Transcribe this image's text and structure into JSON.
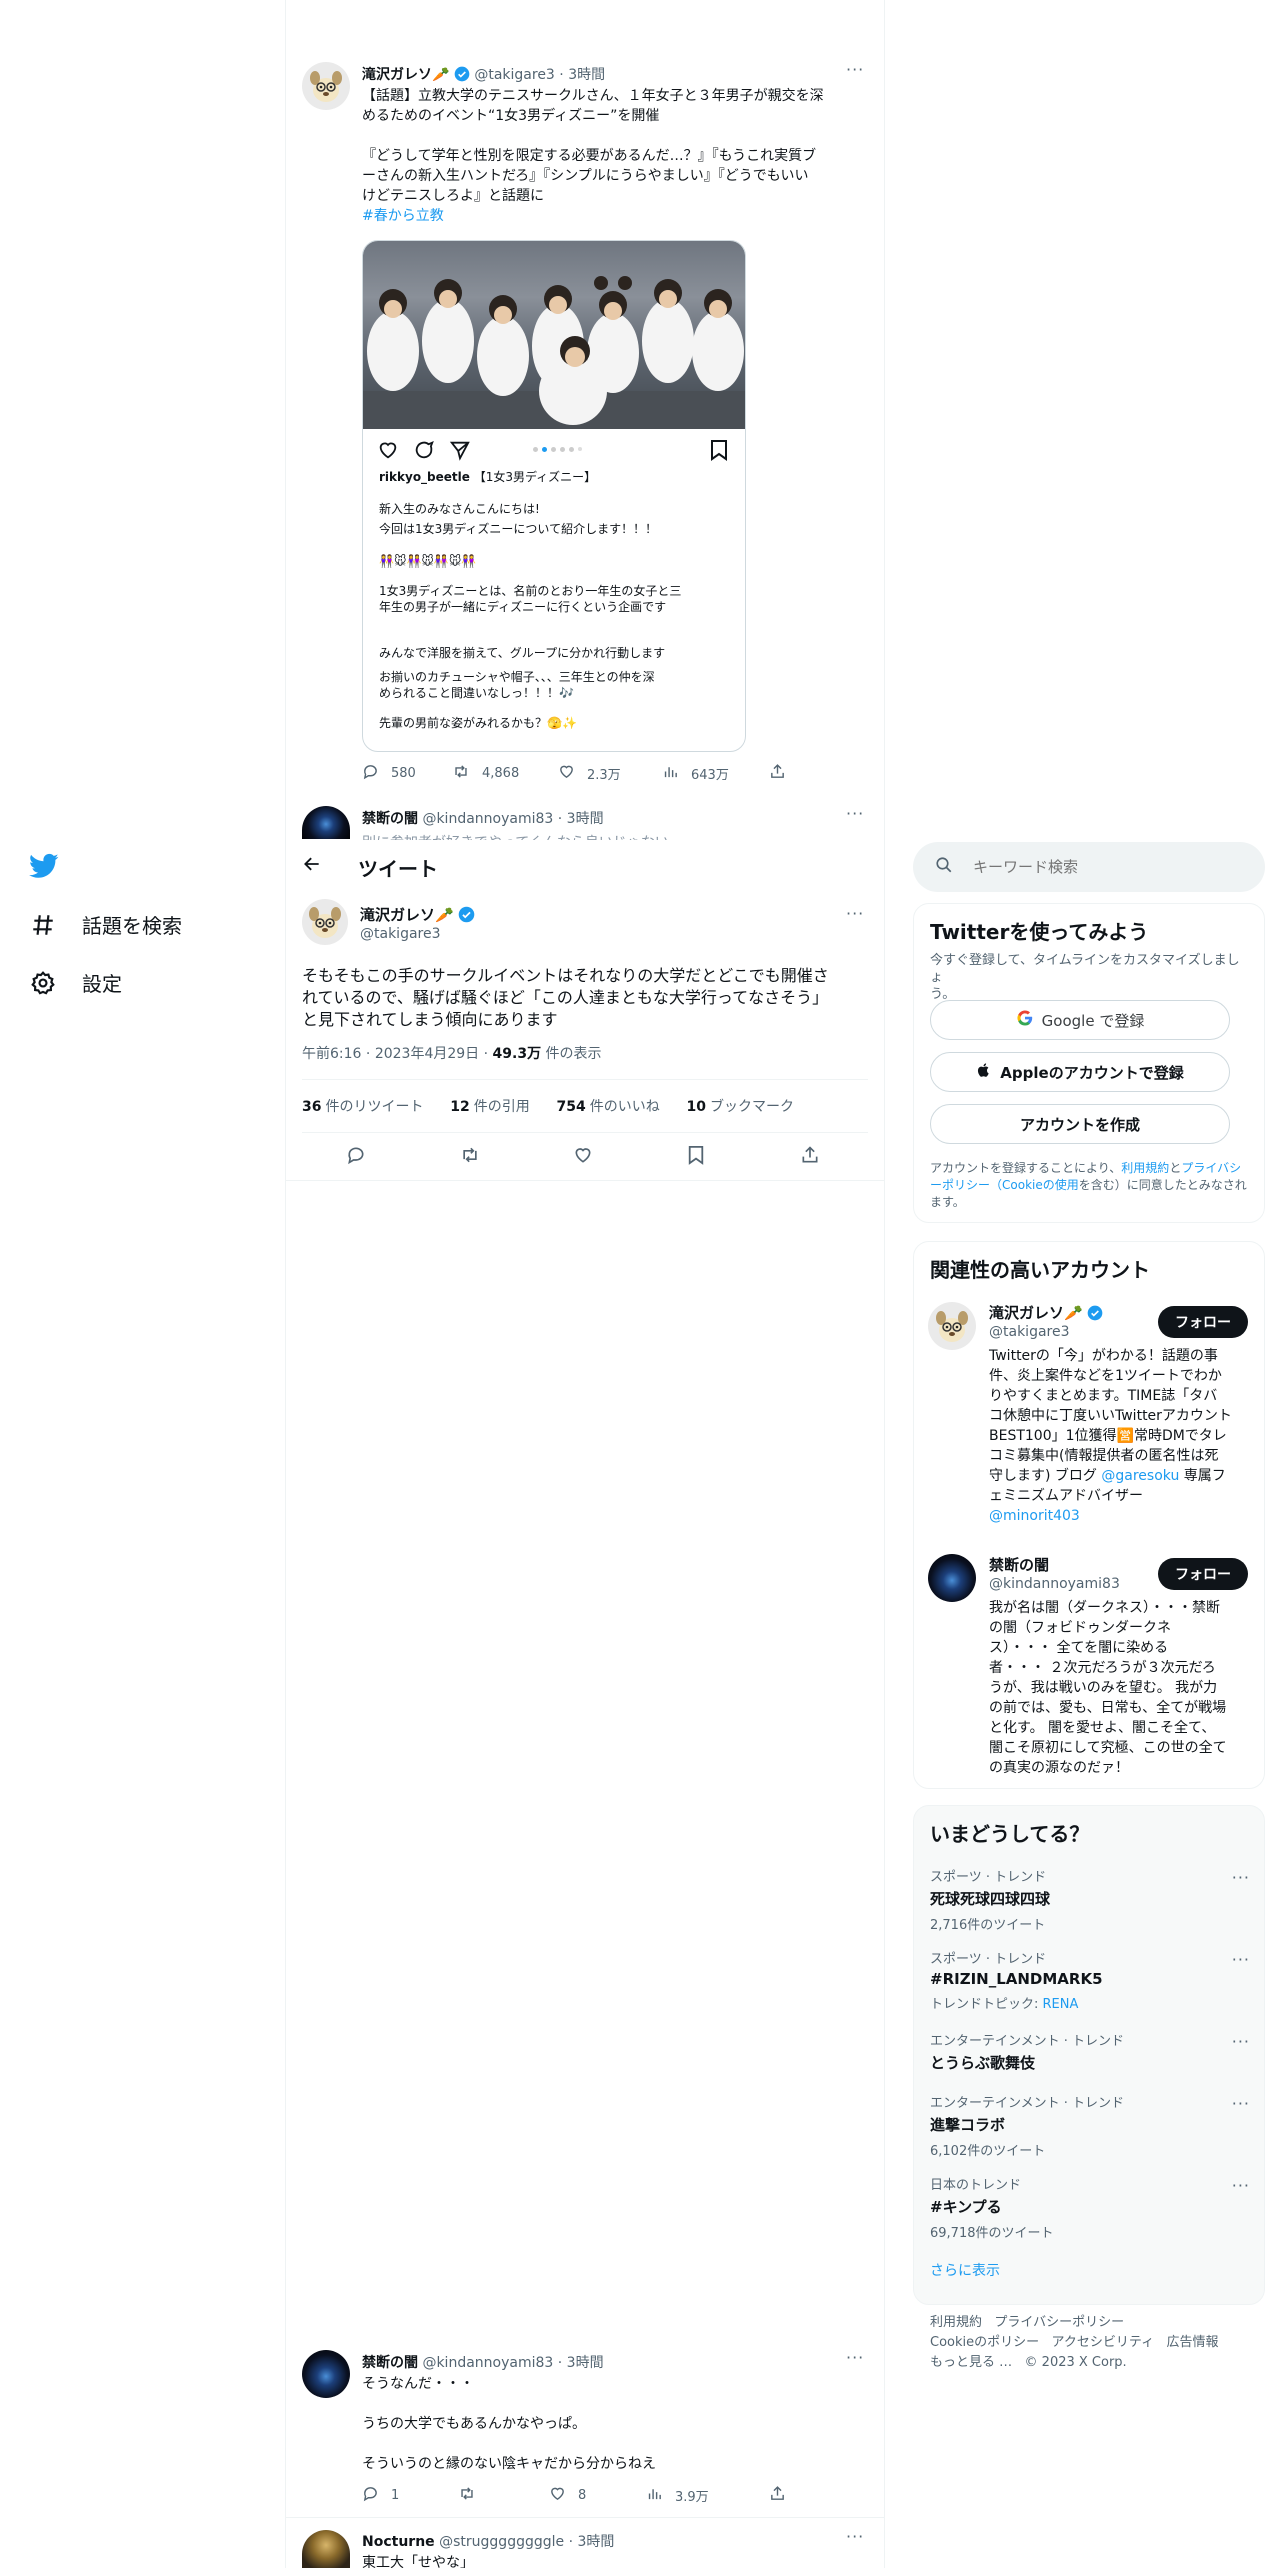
{
  "nav": {
    "explore": "話題を検索",
    "settings": "設定"
  },
  "header": {
    "title": "ツイート"
  },
  "search": {
    "placeholder": "キーワード検索"
  },
  "quoted_tweet": {
    "name": "滝沢ガレソ",
    "name_emoji": "🥕",
    "handle": "@takigare3",
    "time": "3時間",
    "text_line1": "【話題】立教大学のテニスサークルさん、１年女子と３年男子が親交を深",
    "text_line2": "めるためのイベント“1女3男ディズニー”を開催",
    "text_line3": "『どうして学年と性別を限定する必要があるんだ…？』『もうこれ実質ブ",
    "text_line4": "ーさんの新入生ハントだろ』『シンプルにうらやましい』『どうでもいい",
    "text_line5": "けどテニスしろよ』と話題に",
    "hashtag": "#春から立教",
    "insta_user": "rikkyo_beetle",
    "insta_title": "【1女3男ディズニー】",
    "insta_line1": "新入生のみなさんこんにちは!",
    "insta_line2": "今回は1女3男ディズニーについて紹介します！！！",
    "insta_emojis": "👭🐭👭🐭👭🐭👭",
    "insta_line3": "1女3男ディズニーとは、名前のとおり一年生の女子と三",
    "insta_line4": "年生の男子が一緒にディズニーに行くという企画です",
    "insta_line5": "みんなで洋服を揃えて、グループに分かれ行動します",
    "insta_line6": "お揃いのカチューシャや帽子、、、三年生との仲を深",
    "insta_line7": "められること間違いなしっ！！！🎶",
    "insta_line8": "先輩の男前な姿がみれるかも？🫣✨",
    "replies": "580",
    "retweets": "4,868",
    "likes": "2.3万",
    "views": "643万"
  },
  "partial_tweet": {
    "name": "禁断の闇",
    "handle": "@kindannoyami83",
    "time": "3時間",
    "text": "別に参加者が好きでやってくんなら良いじゃない"
  },
  "main_tweet": {
    "name": "滝沢ガレソ",
    "name_emoji": "🥕",
    "handle": "@takigare3",
    "text_line1": "そもそもこの手のサークルイベントはそれなりの大学だとどこでも開催さ",
    "text_line2": "れているので、騒げば騒ぐほど「この人達まともな大学行ってなさそう」",
    "text_line3": "と見下されてしまう傾向にあります",
    "time": "午前6:16",
    "date": "2023年4月29日",
    "views_count": "49.3万",
    "views_label": "件の表示",
    "retweets_count": "36",
    "retweets_label": "件のリツイート",
    "quotes_count": "12",
    "quotes_label": "件の引用",
    "likes_count": "754",
    "likes_label": "件のいいね",
    "bookmarks_count": "10",
    "bookmarks_label": "ブックマーク"
  },
  "reply1": {
    "name": "禁断の闇",
    "handle": "@kindannoyami83",
    "time": "3時間",
    "line1": "そうなんだ・・・",
    "line2": "うちの大学でもあるんかなやっぱ。",
    "line3": "そういうのと縁のない陰キャだから分からねえ",
    "replies": "1",
    "retweets": "",
    "likes": "8",
    "views": "3.9万"
  },
  "reply2": {
    "name": "Nocturne",
    "handle": "@struggggggggle",
    "time": "3時間",
    "text": "東工大「せやな」"
  },
  "signup": {
    "title": "Twitterを使ってみよう",
    "subtitle_line1": "今すぐ登録して、タイムラインをカスタマイズしましょ",
    "subtitle_line2": "う。",
    "google_label": "Google で登録",
    "apple_label": "Appleのアカウントで登録",
    "create_label": "アカウントを作成",
    "terms_pre": "アカウントを登録することにより、",
    "terms_link1": "利用規約",
    "terms_and": "と",
    "terms_link2": "プライバシーポリシー（Cookieの使用",
    "terms_post": "を含む）に同意したとみなされます。"
  },
  "related": {
    "title": "関連性の高いアカウント",
    "follow_label": "フォロー",
    "accounts": [
      {
        "name": "滝沢ガレソ",
        "name_emoji": "🥕",
        "handle": "@takigare3",
        "bio_l1": "Twitterの「今」がわかる！話題の事",
        "bio_l2": "件、炎上案件などを1ツイートでわか",
        "bio_l3": "りやすくまとめます。TIME誌「タバ",
        "bio_l4": "コ休憩中に丁度いいTwitterアカウント",
        "bio_l5": "BEST100」1位獲得🈺常時DMでタレ",
        "bio_l6": "コミ募集中(情報提供者の匿名性は死",
        "bio_l7": "守します) ブログ",
        "bio_link1": "@garesoku",
        "bio_l7b": "専属フ",
        "bio_l8": "ェミニズムアドバイザー",
        "bio_link2": "@minorit403"
      },
      {
        "name": "禁断の闇",
        "handle": "@kindannoyami83",
        "bio_l1": "我が名は闇（ダークネス）・・・禁断",
        "bio_l2": "の闇（フォビドゥンダークネ",
        "bio_l3": "ス）・・・ 全てを闇に染める",
        "bio_l4": "者・・・ ２次元だろうが３次元だろ",
        "bio_l5": "うが、我は戦いのみを望む。 我が力",
        "bio_l6": "の前では、愛も、日常も、全てが戦場",
        "bio_l7": "と化す。 闇を愛せよ、闇こそ全て、",
        "bio_l8": "闇こそ原初にして究極、この世の全て",
        "bio_l9": "の真実の源なのだァ！"
      }
    ]
  },
  "trends": {
    "title": "いまどうしてる？",
    "items": [
      {
        "category": "スポーツ · トレンド",
        "name": "死球死球四球四球",
        "count": "2,716件のツイート"
      },
      {
        "category": "スポーツ · トレンド",
        "name": "#RIZIN_LANDMARK5",
        "count_pre": "トレンドトピック: ",
        "count_link": "RENA"
      },
      {
        "category": "エンターテインメント · トレンド",
        "name": "とうらぶ歌舞伎",
        "count": ""
      },
      {
        "category": "エンターテインメント · トレンド",
        "name": "進撃コラボ",
        "count": "6,102件のツイート"
      },
      {
        "category": "日本のトレンド",
        "name": "#キンプる",
        "count": "69,718件のツイート"
      }
    ],
    "show_more": "さらに表示"
  },
  "footer": {
    "terms": "利用規約",
    "privacy": "プライバシーポリシー",
    "cookie": "Cookieのポリシー",
    "accessibility": "アクセシビリティ",
    "ads": "広告情報",
    "more": "もっと見る …",
    "copyright": "© 2023 X Corp."
  },
  "colors": {
    "brand": "#1d9bf0",
    "text": "#0f1419",
    "muted": "#536471",
    "border": "#eff3f4"
  }
}
